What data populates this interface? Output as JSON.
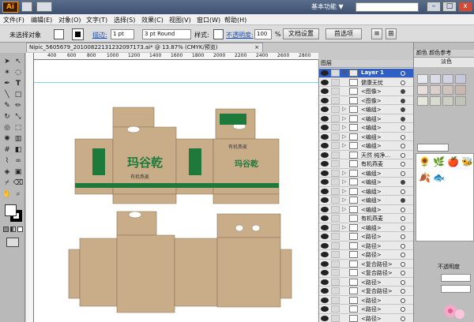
{
  "titlebar": {
    "app_logo": "Ai",
    "workspace": "基本功能",
    "workspace_arrow": "▼",
    "buttons": {
      "minimize": "–",
      "maximize": "□",
      "close": "x"
    }
  },
  "menubar": {
    "items": [
      "文件(F)",
      "编辑(E)",
      "对象(O)",
      "文字(T)",
      "选择(S)",
      "效果(C)",
      "视图(V)",
      "窗口(W)",
      "帮助(H)"
    ]
  },
  "controlbar": {
    "selection_status": "未选择对象",
    "stroke_label": "描边:",
    "stroke_weight": "1 pt",
    "brush": "3 pt Round",
    "style_label": "样式:",
    "opacity_label": "不透明度:",
    "opacity_value": "100",
    "opacity_unit": "%",
    "doc_setup_button": "文档设置",
    "preferences_button": "首选项",
    "fill_color": "#ffffff",
    "stroke_color": "#000000"
  },
  "document": {
    "tab_title": "Nipic_5605679_20100822131232097173.ai* @ 13.87% (CMYK/预览)",
    "tab_close": "×",
    "ruler_numbers": [
      "400",
      "600",
      "800",
      "1000",
      "1200",
      "1400",
      "1600",
      "1800",
      "2000",
      "2200",
      "2400",
      "2600",
      "2800",
      "3000"
    ]
  },
  "artwork": {
    "brand_name": "玛谷乾",
    "subtitle": "有机燕麦",
    "slogan": "健康生活",
    "accent_green": "#1e7a3a",
    "kraft_color": "#c9ad89"
  },
  "layers_panel": {
    "title": "图层",
    "rows": [
      {
        "name": "Layer 1",
        "type": "layer",
        "target": "open"
      },
      {
        "name": "健康无忧",
        "type": "item",
        "target": "open"
      },
      {
        "name": "<图像>",
        "type": "item",
        "target": "filled"
      },
      {
        "name": "<图像>",
        "type": "item",
        "target": "filled"
      },
      {
        "name": "<编组>",
        "type": "group",
        "target": "filled"
      },
      {
        "name": "<编组>",
        "type": "group",
        "target": "filled"
      },
      {
        "name": "<编组>",
        "type": "group",
        "target": "open"
      },
      {
        "name": "<编组>",
        "type": "group",
        "target": "open"
      },
      {
        "name": "<编组>",
        "type": "group",
        "target": "open"
      },
      {
        "name": "天然 纯净…",
        "type": "item",
        "target": "open"
      },
      {
        "name": "有机燕麦",
        "type": "item",
        "target": "open"
      },
      {
        "name": "<编组>",
        "type": "group",
        "target": "open"
      },
      {
        "name": "<编组>",
        "type": "group",
        "target": "filled"
      },
      {
        "name": "<编组>",
        "type": "group",
        "target": "open"
      },
      {
        "name": "<编组>",
        "type": "group",
        "target": "filled"
      },
      {
        "name": "<编组>",
        "type": "group",
        "target": "open"
      },
      {
        "name": "有机燕麦",
        "type": "item",
        "target": "open"
      },
      {
        "name": "<编组>",
        "type": "group",
        "target": "open"
      },
      {
        "name": "<路径>",
        "type": "item",
        "target": "open"
      },
      {
        "name": "<路径>",
        "type": "item",
        "target": "open"
      },
      {
        "name": "<路径>",
        "type": "item",
        "target": "open"
      },
      {
        "name": "<复合路径>",
        "type": "item",
        "target": "open"
      },
      {
        "name": "<复合路径>",
        "type": "item",
        "target": "open"
      },
      {
        "name": "<路径>",
        "type": "item",
        "target": "open"
      },
      {
        "name": "<复合路径>",
        "type": "item",
        "target": "open"
      },
      {
        "name": "<路径>",
        "type": "item",
        "target": "open"
      },
      {
        "name": "<路径>",
        "type": "item",
        "target": "open"
      },
      {
        "name": "<路径>",
        "type": "item",
        "target": "open"
      },
      {
        "name": "<路径>",
        "type": "item",
        "target": "open"
      }
    ]
  },
  "right_dock": {
    "tabs": "颜色 颜色参考",
    "active_tab": "淡色",
    "symbols": [
      "🌻",
      "🌿",
      "🍎",
      "🐝",
      "🍂",
      "🐟"
    ],
    "transparency_label": "不透明度",
    "swatch_colors": [
      "#e8e8ef",
      "#dcdce8",
      "#d2d2e2",
      "#c8c8dc",
      "#e8dedc",
      "#dcd0cc",
      "#d2c4bc",
      "#c8b8ae",
      "#e4e8dc",
      "#d8dcd0",
      "#ccd0c4",
      "#c0c4b8"
    ]
  }
}
